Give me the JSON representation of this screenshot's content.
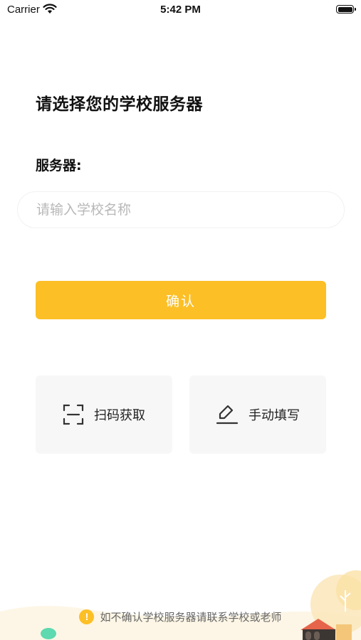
{
  "status_bar": {
    "carrier": "Carrier",
    "time": "5:42 PM"
  },
  "page_title": "请选择您的学校服务器",
  "server_label": "服务器:",
  "search": {
    "placeholder": "请输入学校名称",
    "value": ""
  },
  "confirm_label": "确认",
  "options": {
    "scan_label": "扫码获取",
    "manual_label": "手动填写"
  },
  "footer_note": "如不确认学校服务器请联系学校或老师",
  "colors": {
    "accent": "#fcbf25",
    "card_bg": "#f7f7f7"
  }
}
